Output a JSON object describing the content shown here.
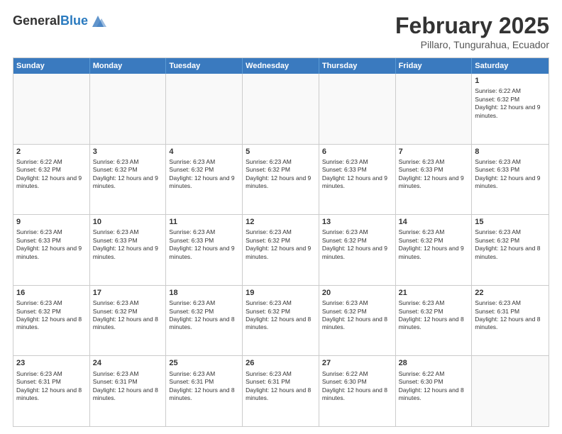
{
  "header": {
    "logo": {
      "general": "General",
      "blue": "Blue"
    },
    "title": "February 2025",
    "location": "Pillaro, Tungurahua, Ecuador"
  },
  "calendar": {
    "weekdays": [
      "Sunday",
      "Monday",
      "Tuesday",
      "Wednesday",
      "Thursday",
      "Friday",
      "Saturday"
    ],
    "rows": [
      [
        {
          "day": "",
          "text": ""
        },
        {
          "day": "",
          "text": ""
        },
        {
          "day": "",
          "text": ""
        },
        {
          "day": "",
          "text": ""
        },
        {
          "day": "",
          "text": ""
        },
        {
          "day": "",
          "text": ""
        },
        {
          "day": "1",
          "text": "Sunrise: 6:22 AM\nSunset: 6:32 PM\nDaylight: 12 hours and 9 minutes."
        }
      ],
      [
        {
          "day": "2",
          "text": "Sunrise: 6:22 AM\nSunset: 6:32 PM\nDaylight: 12 hours and 9 minutes."
        },
        {
          "day": "3",
          "text": "Sunrise: 6:23 AM\nSunset: 6:32 PM\nDaylight: 12 hours and 9 minutes."
        },
        {
          "day": "4",
          "text": "Sunrise: 6:23 AM\nSunset: 6:32 PM\nDaylight: 12 hours and 9 minutes."
        },
        {
          "day": "5",
          "text": "Sunrise: 6:23 AM\nSunset: 6:32 PM\nDaylight: 12 hours and 9 minutes."
        },
        {
          "day": "6",
          "text": "Sunrise: 6:23 AM\nSunset: 6:33 PM\nDaylight: 12 hours and 9 minutes."
        },
        {
          "day": "7",
          "text": "Sunrise: 6:23 AM\nSunset: 6:33 PM\nDaylight: 12 hours and 9 minutes."
        },
        {
          "day": "8",
          "text": "Sunrise: 6:23 AM\nSunset: 6:33 PM\nDaylight: 12 hours and 9 minutes."
        }
      ],
      [
        {
          "day": "9",
          "text": "Sunrise: 6:23 AM\nSunset: 6:33 PM\nDaylight: 12 hours and 9 minutes."
        },
        {
          "day": "10",
          "text": "Sunrise: 6:23 AM\nSunset: 6:33 PM\nDaylight: 12 hours and 9 minutes."
        },
        {
          "day": "11",
          "text": "Sunrise: 6:23 AM\nSunset: 6:33 PM\nDaylight: 12 hours and 9 minutes."
        },
        {
          "day": "12",
          "text": "Sunrise: 6:23 AM\nSunset: 6:32 PM\nDaylight: 12 hours and 9 minutes."
        },
        {
          "day": "13",
          "text": "Sunrise: 6:23 AM\nSunset: 6:32 PM\nDaylight: 12 hours and 9 minutes."
        },
        {
          "day": "14",
          "text": "Sunrise: 6:23 AM\nSunset: 6:32 PM\nDaylight: 12 hours and 9 minutes."
        },
        {
          "day": "15",
          "text": "Sunrise: 6:23 AM\nSunset: 6:32 PM\nDaylight: 12 hours and 8 minutes."
        }
      ],
      [
        {
          "day": "16",
          "text": "Sunrise: 6:23 AM\nSunset: 6:32 PM\nDaylight: 12 hours and 8 minutes."
        },
        {
          "day": "17",
          "text": "Sunrise: 6:23 AM\nSunset: 6:32 PM\nDaylight: 12 hours and 8 minutes."
        },
        {
          "day": "18",
          "text": "Sunrise: 6:23 AM\nSunset: 6:32 PM\nDaylight: 12 hours and 8 minutes."
        },
        {
          "day": "19",
          "text": "Sunrise: 6:23 AM\nSunset: 6:32 PM\nDaylight: 12 hours and 8 minutes."
        },
        {
          "day": "20",
          "text": "Sunrise: 6:23 AM\nSunset: 6:32 PM\nDaylight: 12 hours and 8 minutes."
        },
        {
          "day": "21",
          "text": "Sunrise: 6:23 AM\nSunset: 6:32 PM\nDaylight: 12 hours and 8 minutes."
        },
        {
          "day": "22",
          "text": "Sunrise: 6:23 AM\nSunset: 6:31 PM\nDaylight: 12 hours and 8 minutes."
        }
      ],
      [
        {
          "day": "23",
          "text": "Sunrise: 6:23 AM\nSunset: 6:31 PM\nDaylight: 12 hours and 8 minutes."
        },
        {
          "day": "24",
          "text": "Sunrise: 6:23 AM\nSunset: 6:31 PM\nDaylight: 12 hours and 8 minutes."
        },
        {
          "day": "25",
          "text": "Sunrise: 6:23 AM\nSunset: 6:31 PM\nDaylight: 12 hours and 8 minutes."
        },
        {
          "day": "26",
          "text": "Sunrise: 6:23 AM\nSunset: 6:31 PM\nDaylight: 12 hours and 8 minutes."
        },
        {
          "day": "27",
          "text": "Sunrise: 6:22 AM\nSunset: 6:30 PM\nDaylight: 12 hours and 8 minutes."
        },
        {
          "day": "28",
          "text": "Sunrise: 6:22 AM\nSunset: 6:30 PM\nDaylight: 12 hours and 8 minutes."
        },
        {
          "day": "",
          "text": ""
        }
      ]
    ]
  }
}
